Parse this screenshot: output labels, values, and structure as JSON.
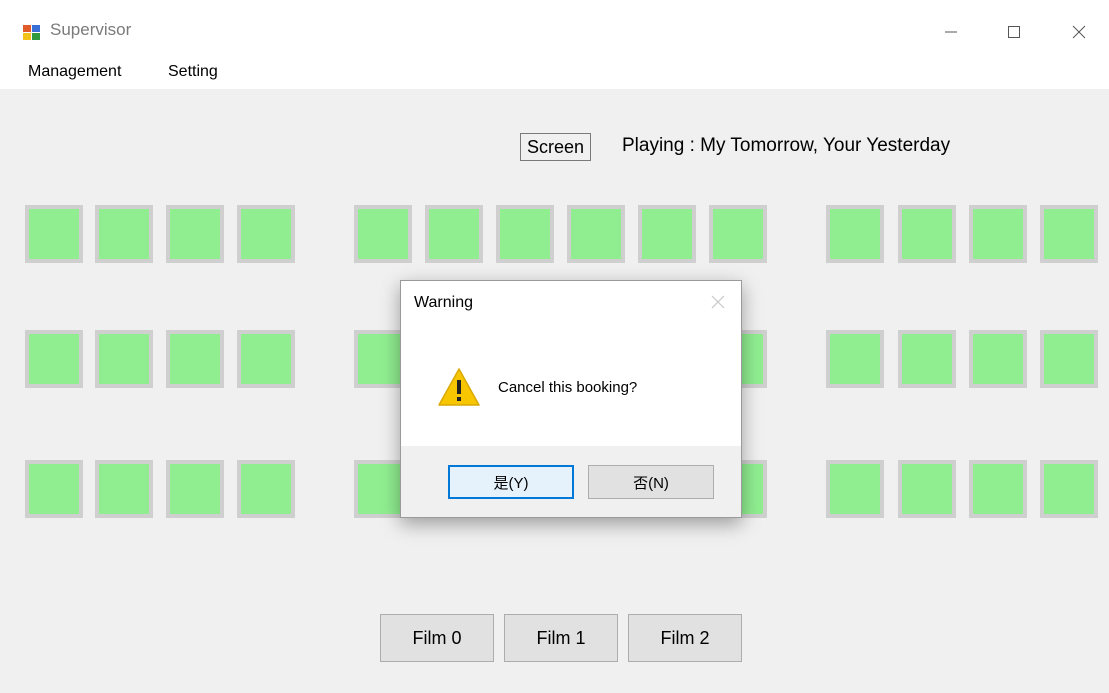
{
  "window": {
    "title": "Supervisor"
  },
  "menu": {
    "items": [
      "Management",
      "Setting"
    ]
  },
  "cinema": {
    "screen_label": "Screen",
    "playing_text": "Playing : My Tomorrow, Your Yesterday",
    "seat_color": "#90ee90"
  },
  "films": [
    "Film 0",
    "Film 1",
    "Film 2"
  ],
  "dialog": {
    "title": "Warning",
    "message": "Cancel this booking?",
    "yes_label": "是(Y)",
    "no_label": "否(N)"
  }
}
